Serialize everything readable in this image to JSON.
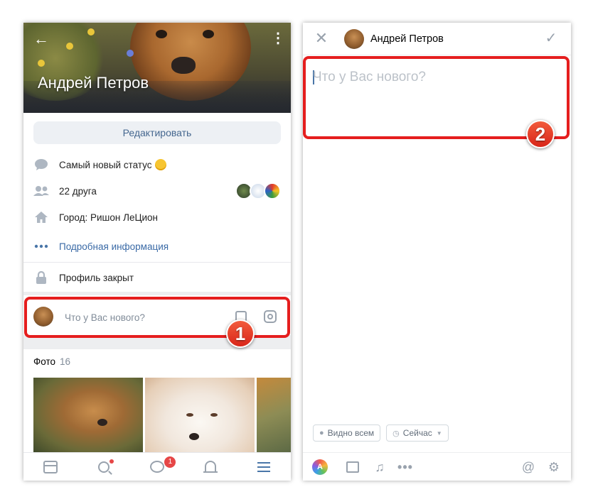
{
  "profile": {
    "name": "Андрей Петров",
    "edit_label": "Редактировать",
    "status_text": "Самый новый статус",
    "friends_text": "22 друга",
    "city_text": "Город: Ришон ЛеЦион",
    "details_text": "Подробная информация",
    "private_text": "Профиль закрыт"
  },
  "composer": {
    "placeholder": "Что у Вас нового?"
  },
  "photos": {
    "title": "Фото",
    "count": "16"
  },
  "tabbar": {
    "messages_badge": "1",
    "icons": [
      "news-icon",
      "search-icon",
      "messages-icon",
      "notifications-icon",
      "menu-icon"
    ]
  },
  "editor": {
    "author_name": "Андрей Петров",
    "placeholder": "Что у Вас нового?",
    "visibility_label": "Видно всем",
    "time_label": "Сейчас"
  },
  "annotations": {
    "step1": "1",
    "step2": "2"
  },
  "colors": {
    "accent": "#4a76a8",
    "link": "#3a6aa6",
    "annotation_red": "#e51e1e",
    "badge_red": "#e64646",
    "icon_gray": "#99a2ad"
  }
}
